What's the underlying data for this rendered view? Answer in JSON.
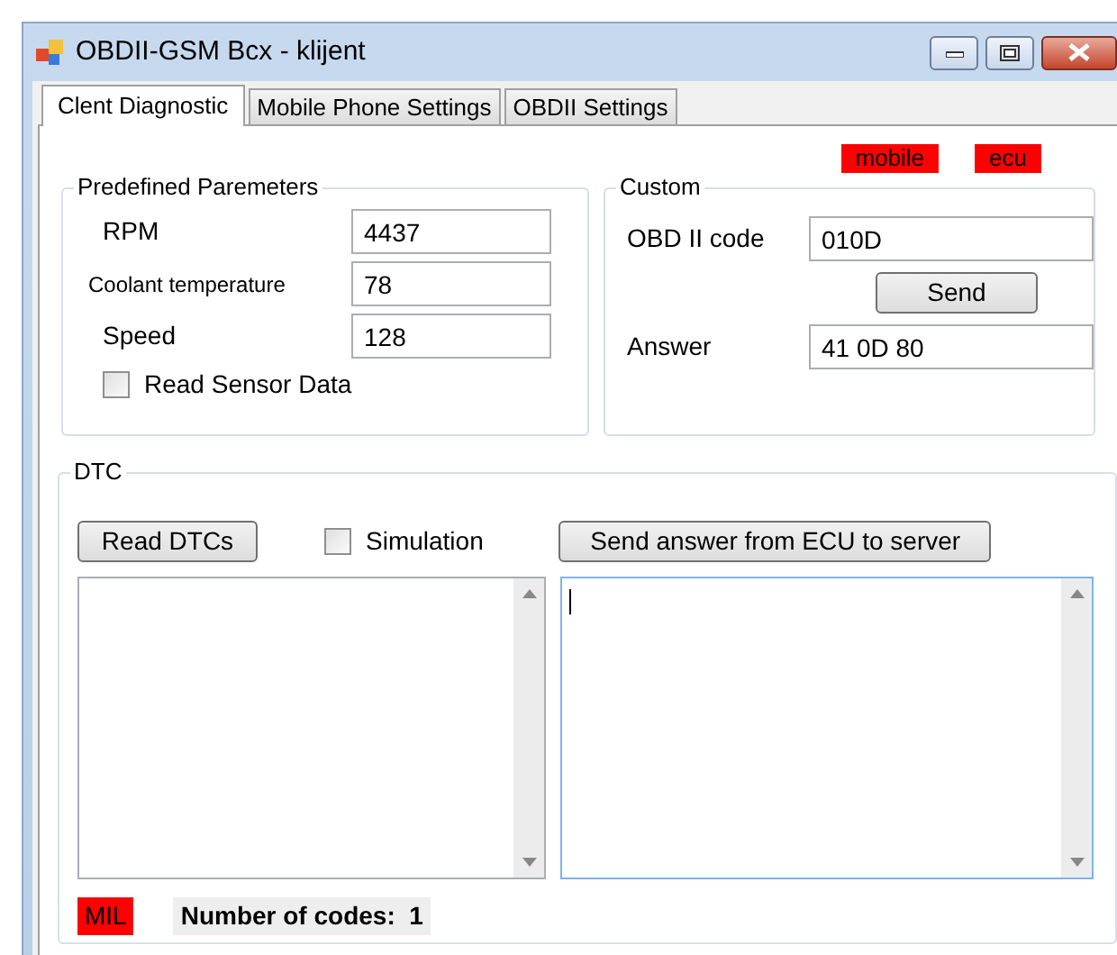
{
  "window": {
    "title": "OBDII-GSM Bcx - klijent"
  },
  "tabs": [
    {
      "label": "Clent Diagnostic",
      "selected": true
    },
    {
      "label": "Mobile Phone Settings",
      "selected": false
    },
    {
      "label": "OBDII Settings",
      "selected": false
    }
  ],
  "indicators": [
    "mobile",
    "ecu"
  ],
  "predefined": {
    "title": "Predefined Paremeters",
    "fields": [
      {
        "label": "RPM",
        "value": "4437",
        "kind": "normal"
      },
      {
        "label": "Coolant temperature",
        "value": "78",
        "kind": "small"
      },
      {
        "label": "Speed",
        "value": "128",
        "kind": "normal"
      }
    ],
    "read_sensor": {
      "label": "Read Sensor Data",
      "checked": false
    }
  },
  "custom": {
    "title": "Custom",
    "code_label": "OBD II code",
    "code_value": "010D",
    "send_button": "Send",
    "answer_label": "Answer",
    "answer_value": "41 0D 80"
  },
  "dtc": {
    "title": "DTC",
    "read_button": "Read DTCs",
    "simulation": {
      "label": "Simulation",
      "checked": false
    },
    "send_server_button": "Send answer from ECU to server",
    "log_focused": true,
    "mil": "MIL",
    "code_count": "Number of codes:  1"
  }
}
